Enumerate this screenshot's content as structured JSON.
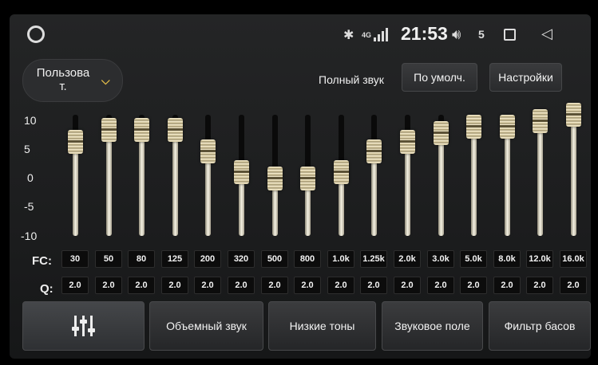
{
  "status": {
    "network": "4G",
    "time": "21:53",
    "volume": "5",
    "icons": [
      "home-circle-icon",
      "bluetooth-icon",
      "signal-icon",
      "volume-icon",
      "recent-apps-icon",
      "back-icon"
    ]
  },
  "preset": {
    "label": "Пользова\nт."
  },
  "header": {
    "full_sound": "Полный звук",
    "default_btn": "По умолч.",
    "settings_btn": "Настройки"
  },
  "eq": {
    "y_labels": [
      "10",
      "5",
      "0",
      "-5",
      "-10"
    ],
    "fc_label": "FC:",
    "q_label": "Q:",
    "bands": [
      {
        "fc": "30",
        "q": "2.0",
        "gain": 5.5
      },
      {
        "fc": "50",
        "q": "2.0",
        "gain": 7.5
      },
      {
        "fc": "80",
        "q": "2.0",
        "gain": 7.5
      },
      {
        "fc": "125",
        "q": "2.0",
        "gain": 7.5
      },
      {
        "fc": "200",
        "q": "2.0",
        "gain": 4.0
      },
      {
        "fc": "320",
        "q": "2.0",
        "gain": 0.5
      },
      {
        "fc": "500",
        "q": "2.0",
        "gain": -0.5
      },
      {
        "fc": "800",
        "q": "2.0",
        "gain": -0.5
      },
      {
        "fc": "1.0k",
        "q": "2.0",
        "gain": 0.5
      },
      {
        "fc": "1.25k",
        "q": "2.0",
        "gain": 4.0
      },
      {
        "fc": "2.0k",
        "q": "2.0",
        "gain": 5.5
      },
      {
        "fc": "3.0k",
        "q": "2.0",
        "gain": 7.0
      },
      {
        "fc": "5.0k",
        "q": "2.0",
        "gain": 8.0
      },
      {
        "fc": "8.0k",
        "q": "2.0",
        "gain": 8.0
      },
      {
        "fc": "12.0k",
        "q": "2.0",
        "gain": 9.0
      },
      {
        "fc": "16.0k",
        "q": "2.0",
        "gain": 10.0
      }
    ]
  },
  "tabs": {
    "eq_icon": "equalizer-icon",
    "surround": "Объемный звук",
    "bass": "Низкие тоны",
    "sound_field": "Звуковое поле",
    "bass_filter": "Фильтр басов"
  }
}
